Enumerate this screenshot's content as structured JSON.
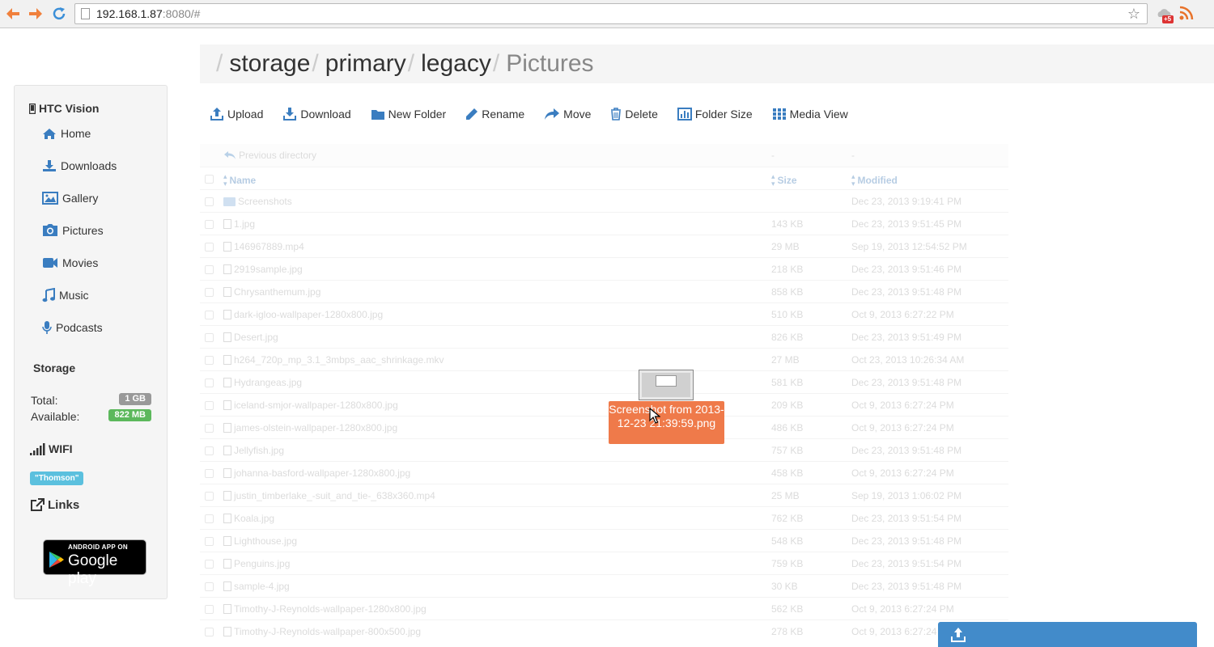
{
  "browser": {
    "url_host": "192.168.1.87",
    "url_rest": ":8080/#",
    "ext_badge": "+5"
  },
  "breadcrumb": {
    "separator": "/",
    "items": [
      "storage",
      "primary",
      "legacy"
    ],
    "active": "Pictures"
  },
  "sidebar": {
    "device_name": "HTC Vision",
    "items": [
      {
        "label": "Home",
        "icon": "home-icon"
      },
      {
        "label": "Downloads",
        "icon": "download-icon"
      },
      {
        "label": "Gallery",
        "icon": "picture-icon"
      },
      {
        "label": "Pictures",
        "icon": "camera-icon"
      },
      {
        "label": "Movies",
        "icon": "video-icon"
      },
      {
        "label": "Music",
        "icon": "music-icon"
      },
      {
        "label": "Podcasts",
        "icon": "microphone-icon"
      }
    ],
    "storage_title": "Storage",
    "total_label": "Total:",
    "total_value": "1 GB",
    "available_label": "Available:",
    "available_value": "822 MB",
    "wifi_title": "WIFI",
    "wifi_ssid": "\"Thomson\"",
    "links_title": "Links",
    "play_small": "ANDROID APP ON",
    "play_big": "Google play"
  },
  "toolbar": {
    "upload": "Upload",
    "download": "Download",
    "new_folder": "New Folder",
    "rename": "Rename",
    "move": "Move",
    "delete": "Delete",
    "folder_size": "Folder Size",
    "media_view": "Media View"
  },
  "table": {
    "previous_label": "Previous directory",
    "previous_size": "-",
    "previous_modified": "-",
    "headers": {
      "name": "Name",
      "size": "Size",
      "modified": "Modified"
    },
    "rows": [
      {
        "name": "Screenshots",
        "size": "",
        "modified": "Dec 23, 2013 9:19:41 PM",
        "type": "folder"
      },
      {
        "name": "1.jpg",
        "size": "143 KB",
        "modified": "Dec 23, 2013 9:51:45 PM",
        "type": "file"
      },
      {
        "name": "146967889.mp4",
        "size": "29 MB",
        "modified": "Sep 19, 2013 12:54:52 PM",
        "type": "file"
      },
      {
        "name": "2919sample.jpg",
        "size": "218 KB",
        "modified": "Dec 23, 2013 9:51:46 PM",
        "type": "file"
      },
      {
        "name": "Chrysanthemum.jpg",
        "size": "858 KB",
        "modified": "Dec 23, 2013 9:51:48 PM",
        "type": "file"
      },
      {
        "name": "dark-igloo-wallpaper-1280x800.jpg",
        "size": "510 KB",
        "modified": "Oct 9, 2013 6:27:22 PM",
        "type": "file"
      },
      {
        "name": "Desert.jpg",
        "size": "826 KB",
        "modified": "Dec 23, 2013 9:51:49 PM",
        "type": "file"
      },
      {
        "name": "h264_720p_mp_3.1_3mbps_aac_shrinkage.mkv",
        "size": "27 MB",
        "modified": "Oct 23, 2013 10:26:34 AM",
        "type": "file"
      },
      {
        "name": "Hydrangeas.jpg",
        "size": "581 KB",
        "modified": "Dec 23, 2013 9:51:48 PM",
        "type": "file"
      },
      {
        "name": "iceland-smjor-wallpaper-1280x800.jpg",
        "size": "209 KB",
        "modified": "Oct 9, 2013 6:27:24 PM",
        "type": "file"
      },
      {
        "name": "james-olstein-wallpaper-1280x800.jpg",
        "size": "486 KB",
        "modified": "Oct 9, 2013 6:27:24 PM",
        "type": "file"
      },
      {
        "name": "Jellyfish.jpg",
        "size": "757 KB",
        "modified": "Dec 23, 2013 9:51:48 PM",
        "type": "file"
      },
      {
        "name": "johanna-basford-wallpaper-1280x800.jpg",
        "size": "458 KB",
        "modified": "Oct 9, 2013 6:27:24 PM",
        "type": "file"
      },
      {
        "name": "justin_timberlake_-suit_and_tie-_638x360.mp4",
        "size": "25 MB",
        "modified": "Sep 19, 2013 1:06:02 PM",
        "type": "file"
      },
      {
        "name": "Koala.jpg",
        "size": "762 KB",
        "modified": "Dec 23, 2013 9:51:54 PM",
        "type": "file"
      },
      {
        "name": "Lighthouse.jpg",
        "size": "548 KB",
        "modified": "Dec 23, 2013 9:51:48 PM",
        "type": "file"
      },
      {
        "name": "Penguins.jpg",
        "size": "759 KB",
        "modified": "Dec 23, 2013 9:51:54 PM",
        "type": "file"
      },
      {
        "name": "sample-4.jpg",
        "size": "30 KB",
        "modified": "Dec 23, 2013 9:51:48 PM",
        "type": "file"
      },
      {
        "name": "Timothy-J-Reynolds-wallpaper-1280x800.jpg",
        "size": "562 KB",
        "modified": "Oct 9, 2013 6:27:24 PM",
        "type": "file"
      },
      {
        "name": "Timothy-J-Reynolds-wallpaper-800x500.jpg",
        "size": "278 KB",
        "modified": "Oct 9, 2013 6:27:24 PM",
        "type": "file"
      }
    ]
  },
  "drag": {
    "label": "Screenshot from 2013-12-23 21:39:59.png"
  },
  "colors": {
    "accent": "#428bca",
    "drag_label": "#ef7a4a",
    "available_badge": "#5cb85c",
    "wifi_badge": "#5bc0de"
  }
}
